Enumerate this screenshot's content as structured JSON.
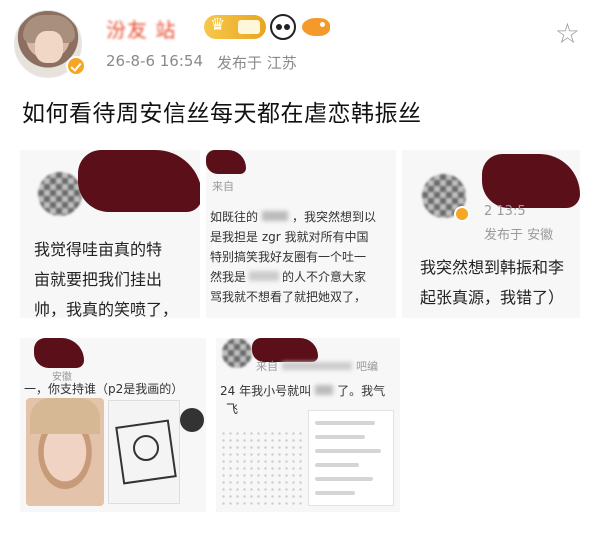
{
  "post": {
    "username": "汾友 站",
    "date": "26-8-6 16:54",
    "location": "发布于 江苏",
    "title": "如何看待周安信丝每天都在虐恋韩振丝"
  },
  "badges": {
    "crown": "crown-badge",
    "panda": "panda-icon",
    "fish": "fish-icon"
  },
  "actions": {
    "star": "☆"
  },
  "tiles": {
    "t1": {
      "lines": [
        "我觉得哇亩真的特",
        "亩就要把我们挂出",
        "帅，我真的笑喷了，"
      ]
    },
    "t2": {
      "header": "来自",
      "lines": [
        "如既往的",
        "是我担是 zgr 我就对所有中国",
        "特别搞笑我好友圈有一个吐一",
        "然我是",
        "骂我就不想看了就把她双了，"
      ],
      "line1_tail": "，我突然想到以",
      "line4_tail": "的人不介意大家"
    },
    "t3": {
      "date_partial": "2          13:5",
      "location": "发布于 安徽",
      "lines": [
        "我突然想到韩振和李",
        "起张真源，我错了）"
      ]
    },
    "t4": {
      "location": "安徽",
      "text": "一，你支持谁（p2是我画的）"
    },
    "t5": {
      "header": "来自",
      "header_tail": "吧编",
      "text": "24 年我小号就叫",
      "text_tail": "了。我气",
      "sub": "飞"
    }
  },
  "colors": {
    "accent": "#e8492b",
    "verified": "#f5a623",
    "meta": "#8a8a8a",
    "redaction": "#5a0f19"
  }
}
